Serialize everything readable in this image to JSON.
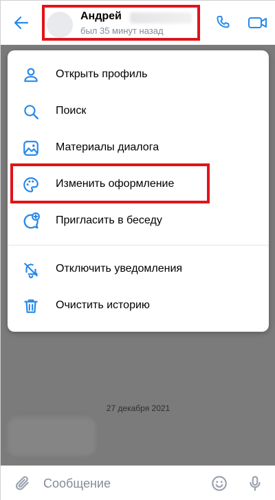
{
  "header": {
    "contact_name": "Андрей",
    "status": "был 35 минут назад",
    "back_icon": "arrow-left-icon",
    "call_icon": "phone-icon",
    "video_icon": "video-camera-icon"
  },
  "menu": {
    "items": [
      {
        "label": "Открыть профиль",
        "icon": "user-icon"
      },
      {
        "label": "Поиск",
        "icon": "search-icon"
      },
      {
        "label": "Материалы диалога",
        "icon": "image-icon"
      },
      {
        "label": "Изменить оформление",
        "icon": "palette-icon"
      },
      {
        "label": "Пригласить в беседу",
        "icon": "chat-add-icon"
      },
      {
        "label": "Отключить уведомления",
        "icon": "notifications-off-icon"
      },
      {
        "label": "Очистить историю",
        "icon": "trash-icon"
      }
    ]
  },
  "chat": {
    "date_separator": "27 декабря 2021"
  },
  "composer": {
    "placeholder": "Сообщение",
    "attach_icon": "paperclip-icon",
    "emoji_icon": "smile-icon",
    "mic_icon": "microphone-icon"
  },
  "colors": {
    "accent": "#2688eb",
    "highlight_border": "#e0141a",
    "overlay": "#7b7b7b",
    "secondary_text": "#818c99"
  }
}
